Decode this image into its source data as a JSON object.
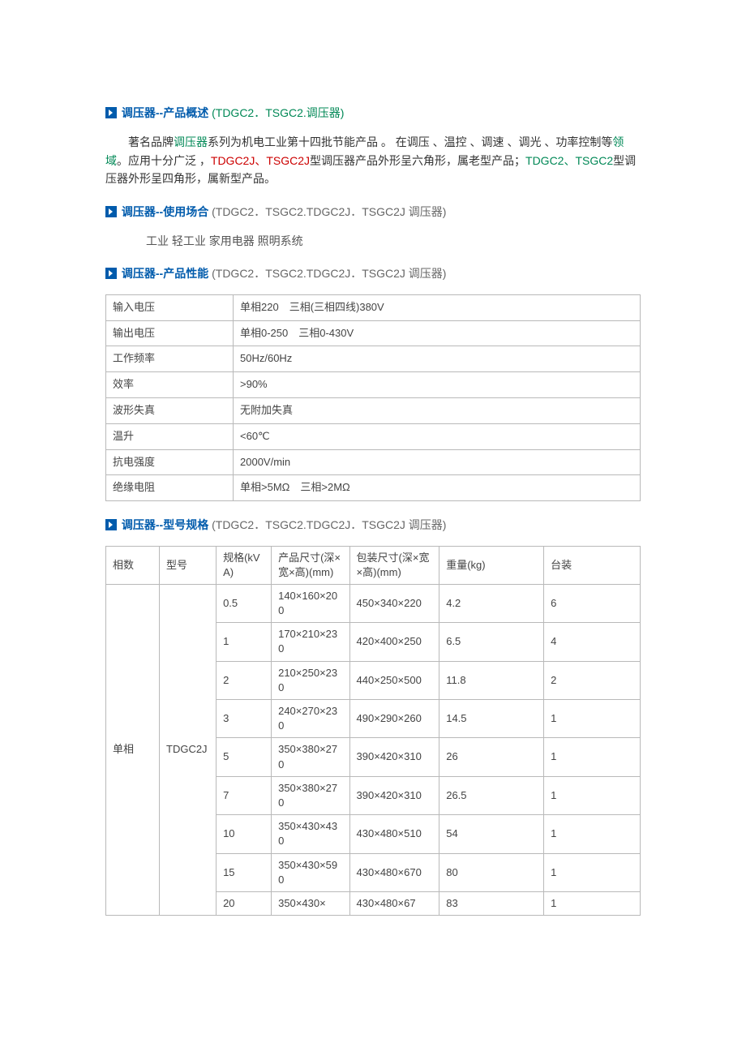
{
  "sections": {
    "overview": {
      "title_blue": "调压器--产品概述",
      "title_suffix": "(TDGC2．TSGC2.调压器)",
      "para_prefix": "著名品牌",
      "para_green1": "调压器",
      "para_mid1": "系列为机电工业第十四批节能产品 。 在调压 、温控 、调速 、调光 、功率控制等",
      "para_green2": "领域",
      "para_mid2": "。应用十分广泛 ，",
      "para_red": "TDGC2J、TSGC2J",
      "para_mid3": "型调压器产品外形呈六角形，属老型产品；",
      "para_green3": "TDGC2、TSGC2",
      "para_mid4": "型调压器外形呈四角形，属新型产品。"
    },
    "usage": {
      "title_blue": "调压器--使用场合",
      "title_suffix": "(TDGC2．TSGC2.TDGC2J．TSGC2J 调压器)",
      "line": "工业  轻工业  家用电器  照明系统"
    },
    "perf": {
      "title_blue": "调压器--产品性能",
      "title_suffix": "(TDGC2．TSGC2.TDGC2J．TSGC2J 调压器)",
      "rows": [
        {
          "k": "输入电压",
          "v": "单相220　三相(三相四线)380V"
        },
        {
          "k": "输出电压",
          "v": "单相0-250　三相0-430V"
        },
        {
          "k": "工作频率",
          "v": "50Hz/60Hz"
        },
        {
          "k": "效率",
          "v": ">90%"
        },
        {
          "k": "波形失真",
          "v": "无附加失真"
        },
        {
          "k": "温升",
          "v": "<60℃"
        },
        {
          "k": "抗电强度",
          "v": "2000V/min"
        },
        {
          "k": "绝缘电阻",
          "v": "单相>5MΩ　三相>2MΩ"
        }
      ]
    },
    "spec": {
      "title_blue": "调压器--型号规格",
      "title_suffix": "(TDGC2．TSGC2.TDGC2J．TSGC2J 调压器)",
      "headers": {
        "phase": "相数",
        "model": "型号",
        "kva": "规格(kVA)",
        "psize": "产品尺寸(深×宽×高)(mm)",
        "bsize": "包装尺寸(深×宽×高)(mm)",
        "weight": "重量(kg)",
        "pack": "台装"
      },
      "phase_label": "单相",
      "model_label": "TDGC2J",
      "rows": [
        {
          "kva": "0.5",
          "psize": "140×160×200",
          "bsize": "450×340×220",
          "weight": "4.2",
          "pack": "6"
        },
        {
          "kva": "1",
          "psize": "170×210×230",
          "bsize": "420×400×250",
          "weight": "6.5",
          "pack": "4"
        },
        {
          "kva": "2",
          "psize": "210×250×230",
          "bsize": "440×250×500",
          "weight": "11.8",
          "pack": "2"
        },
        {
          "kva": "3",
          "psize": "240×270×230",
          "bsize": "490×290×260",
          "weight": "14.5",
          "pack": "1"
        },
        {
          "kva": "5",
          "psize": "350×380×270",
          "bsize": "390×420×310",
          "weight": "26",
          "pack": "1"
        },
        {
          "kva": "7",
          "psize": "350×380×270",
          "bsize": "390×420×310",
          "weight": "26.5",
          "pack": "1"
        },
        {
          "kva": "10",
          "psize": "350×430×430",
          "bsize": "430×480×510",
          "weight": "54",
          "pack": "1"
        },
        {
          "kva": "15",
          "psize": "350×430×590",
          "bsize": "430×480×670",
          "weight": "80",
          "pack": "1"
        },
        {
          "kva": "20",
          "psize": "350×430×",
          "bsize": "430×480×67",
          "weight": "83",
          "pack": "1"
        }
      ]
    }
  }
}
